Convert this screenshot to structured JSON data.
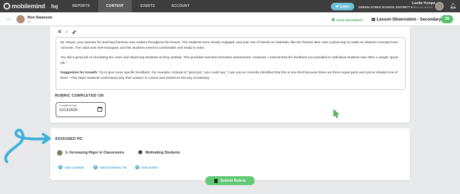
{
  "nav": {
    "logo_text": "mobilemind",
    "logo_hq": "hq",
    "tabs": [
      "REPORTS",
      "CONTENT",
      "EVENTS",
      "ACCOUNT"
    ],
    "active_tab": "CONTENT",
    "learn_label": "Learn",
    "district": "GREEN ACRES SCHOOL DISTRICT",
    "user_name": "Leslie Knope",
    "user_sub": "VIEW HQ ROLES"
  },
  "header": {
    "observee_name": "Ron Swanson",
    "observee_sub": "PE",
    "save_progress": "SAVE PROGRESS",
    "title": "Lesson Observation - Secondary",
    "score": "36"
  },
  "editor": {
    "toolbar": [
      "B",
      "I",
      "link"
    ],
    "paragraph1": "Mr. Dwyer, your passion for teaching fractions was evident throughout the lesson. The students were clearly engaged, and your use of hands-on materials, like the fraction tiles, was a great way to make an abstract concept more concrete. The class was well-managed, and the students seemed comfortable and ready to learn.",
    "paragraph2": "You did a great job of circulating the room and observing students as they worked. This provided real-time formative assessment. However, I noticed that the feedback you provided to individual students was often a simple \"good job.\"",
    "paragraph3_bold": "Suggestion for Growth:",
    "paragraph3": " Try to give more specific feedback. For example, instead of \"good job,\" you could say, \"I see you've correctly identified that this is one-third because there are three equal parts and you've shaded one of them.\" This helps students understand why their answer is correct and reinforces the key vocabulary."
  },
  "rubric": {
    "completed_label": "RUBRIC COMPLETED ON",
    "date_legend": "Completed Date",
    "date_value": "11/13/2025"
  },
  "assigned_pd": {
    "title": "ASSIGNED PD",
    "items": [
      "1- Increasing Rigor in Classrooms",
      "Motivating Students"
    ],
    "links": [
      "ADD COURSE",
      "ADD EXTERNAL PD",
      "ADD EVENT"
    ]
  },
  "submit_label": "Submit Rubric",
  "colors": {
    "nav_bg": "#3d3d3d",
    "accent_blue": "#4aa9d6",
    "accent_green": "#62c976",
    "page_bg": "#e8e9eb"
  }
}
